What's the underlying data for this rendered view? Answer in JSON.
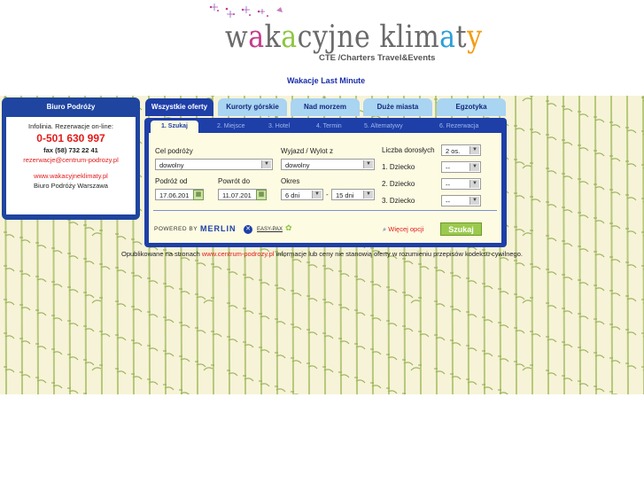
{
  "header": {
    "logo_text_parts": [
      "w",
      "a",
      "k",
      "a",
      "cyjne klim",
      "a",
      "t",
      "y"
    ],
    "logo_subtitle": "CTE /Charters Travel&Events",
    "last_minute_link": "Wakacje Last Minute"
  },
  "office": {
    "title": "Biuro Podróży",
    "hotline": "Infolinia. Rezerwacje on-line:",
    "phone": "0-501 630 997",
    "fax": "fax (58) 732 22 41",
    "email": "rezerwacje@centrum-podrozy.pl",
    "website": "www.wakacyjneklimaty.pl",
    "name": "Biuro Podróży Warszawa"
  },
  "tabs": [
    "Wszystkie oferty",
    "Kurorty górskie",
    "Nad morzem",
    "Duże miasta",
    "Egzotyka"
  ],
  "steps": [
    "1. Szukaj",
    "2. Miejsce",
    "3. Hotel",
    "4. Termin",
    "5. Alternatywy",
    "6. Rezerwacja"
  ],
  "form": {
    "destination_label": "Cel podróży",
    "destination_value": "dowolny",
    "departure_label": "Wyjazd / Wylot z",
    "departure_value": "dowolny",
    "adults_label": "Liczba dorosłych",
    "adults_value": "2 os.",
    "child1_label": "1. Dziecko",
    "child1_value": "--",
    "child2_label": "2. Dziecko",
    "child2_value": "--",
    "child3_label": "3. Dziecko",
    "child3_value": "--",
    "from_label": "Podróż od",
    "from_value": "17.06.201",
    "to_label": "Powrót do",
    "to_value": "11.07.201",
    "period_label": "Okres",
    "period_from": "6 dni",
    "period_to": "15 dni",
    "period_sep": "-",
    "powered_by": "POWERED BY",
    "merlin": "MERLIN",
    "easypax": "EASY-PAX",
    "more_options": "Więcej opcji",
    "search_button": "Szukaj"
  },
  "disclaimer": {
    "before": "Opublikowane na stronach ",
    "link": "www.centrum-podrozy.pl",
    "after": " informacje lub ceny nie stanowią oferty w rozumieniu przepisów kodeksu cywilnego."
  },
  "colors": {
    "panel_blue": "#1e3fa8",
    "tab_light": "#a9d4f2",
    "accent_red": "#e11b1b",
    "button_green": "#9bc94d",
    "form_bg": "#fdfbe2"
  }
}
